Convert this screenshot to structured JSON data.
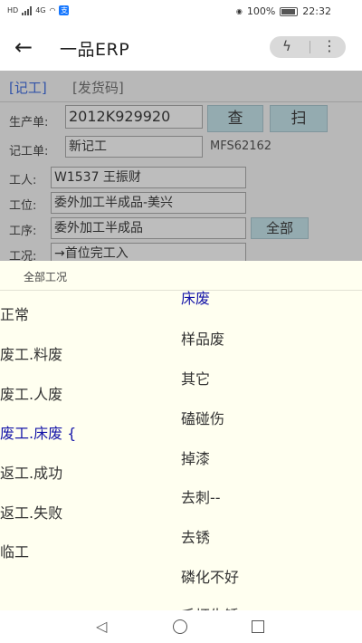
{
  "status": {
    "net_label": "HD",
    "signal_label": "4G",
    "battery": "100%",
    "time": "22:32",
    "alipay_glyph": "支"
  },
  "appbar": {
    "title": "一品ERP",
    "back_glyph": "←",
    "flash_glyph": "ϟ",
    "more_glyph": "⋮"
  },
  "tabs": [
    "[记工]",
    "[发货码]"
  ],
  "form": {
    "production_label": "生产单:",
    "production_value": "2012K929920",
    "check_button": "查",
    "scan_button": "扫",
    "record_label": "记工单:",
    "record_value": "新记工",
    "record_code": "MFS62162",
    "worker_label": "工人:",
    "worker_value": "W1537 王振财",
    "position_label": "工位:",
    "position_value": "委外加工半成品-美兴",
    "process_label": "工序:",
    "process_value": "委外加工半成品",
    "all_button": "全部",
    "condition_label": "工况:",
    "condition_value": "→首位完工入"
  },
  "sheet": {
    "title": "全部工况",
    "left_options": [
      "正常",
      "废工.料废",
      "废工.人废",
      "废工.床废 {",
      "返工.成功",
      "返工.失败",
      "临工"
    ],
    "right_options": [
      "床废",
      "样品废",
      "其它",
      "磕碰伤",
      "掉漆",
      "去刺--",
      "去锈",
      "磷化不好",
      "毛坯生锈"
    ],
    "selected_color": "#1515a8"
  },
  "nav": {
    "back_glyph": "◁"
  }
}
